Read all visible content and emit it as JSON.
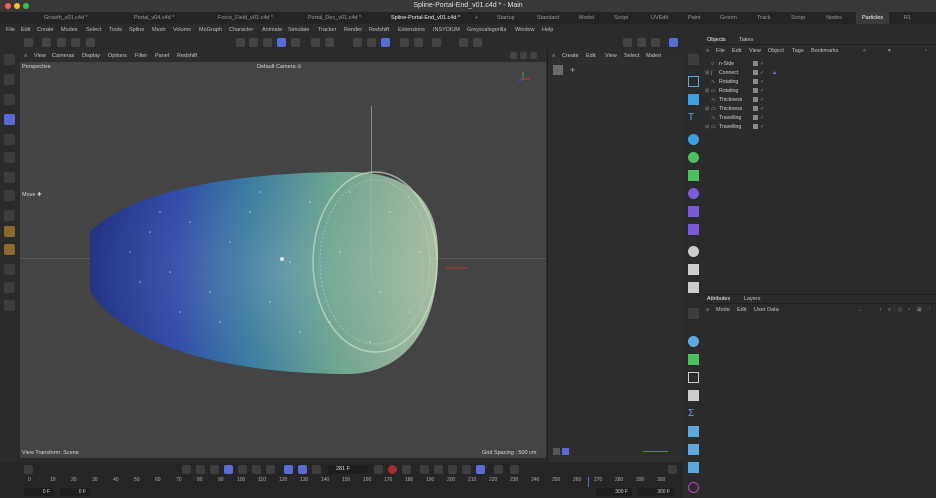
{
  "window": {
    "title": "Spline-Portal-End_v01.c4d * - Main"
  },
  "file_tabs": [
    {
      "label": "Growth_v01.c4d *"
    },
    {
      "label": "Portal_v04.c4d *"
    },
    {
      "label": "Force_Field_v01.c4d *"
    },
    {
      "label": "Portal_Dec_v01.c4d *"
    },
    {
      "label": "Spline-Portal-End_v01.c4d *"
    },
    {
      "label": "+"
    }
  ],
  "layout_tabs": [
    {
      "label": "Startup"
    },
    {
      "label": "Standard"
    },
    {
      "label": "Model"
    },
    {
      "label": "Script"
    },
    {
      "label": "UVEdit"
    },
    {
      "label": "Paint"
    },
    {
      "label": "Groom"
    },
    {
      "label": "Track"
    },
    {
      "label": "Script"
    },
    {
      "label": "Nodes"
    },
    {
      "label": "Particles"
    },
    {
      "label": "R1"
    }
  ],
  "main_menu": [
    "File",
    "Edit",
    "Create",
    "Modes",
    "Select",
    "Tools",
    "Spline",
    "Mesh",
    "Volume",
    "MoGraph",
    "Character",
    "Animate",
    "Simulate",
    "Tracker",
    "Render",
    "Redshift",
    "Extensions",
    "INSYDIUM",
    "Greyscalegorilla",
    "Window",
    "Help"
  ],
  "viewport": {
    "menu": [
      "View",
      "Cameras",
      "Display",
      "Options",
      "Filter",
      "Panel",
      "Redshift"
    ],
    "view_name": "Perspective",
    "camera": "Default Camera ⊙",
    "move_label": "Move ✚",
    "view_transform": "View Transform: Scene",
    "grid_spacing": "Grid Spacing : 500 cm"
  },
  "picture_viewer": {
    "menu": [
      "Create",
      "Edit",
      "View",
      "Select",
      "Materi"
    ]
  },
  "objects_panel": {
    "tabs": [
      "Objects",
      "Takes"
    ],
    "menu": [
      "File",
      "Edit",
      "View",
      "Object",
      "Tags",
      "Bookmarks"
    ],
    "items": [
      {
        "name": "n-Side"
      },
      {
        "name": "Connect"
      },
      {
        "name": "Rotating"
      },
      {
        "name": "Rotating"
      },
      {
        "name": "Thickness"
      },
      {
        "name": "Thickness"
      },
      {
        "name": "Travelling"
      },
      {
        "name": "Travelling"
      }
    ]
  },
  "attributes_panel": {
    "tabs": [
      "Attributes",
      "Layers"
    ],
    "menu": [
      "Mode",
      "Edit",
      "User Data"
    ]
  },
  "timeline": {
    "current_frame": "281 F",
    "start_frame": "0 F",
    "start_frame_2": "0 F",
    "end_frame": "300 F",
    "end_frame_2": "300 F",
    "ruler": [
      "0",
      "10",
      "20",
      "30",
      "40",
      "50",
      "60",
      "70",
      "80",
      "90",
      "100",
      "110",
      "120",
      "130",
      "140",
      "150",
      "160",
      "170",
      "180",
      "190",
      "200",
      "210",
      "220",
      "230",
      "240",
      "250",
      "260",
      "270",
      "280",
      "290",
      "300"
    ]
  },
  "colors": {
    "accent": "#5a6ad8",
    "viewport_bg": "#444444",
    "check_green": "#3ccf4e"
  }
}
